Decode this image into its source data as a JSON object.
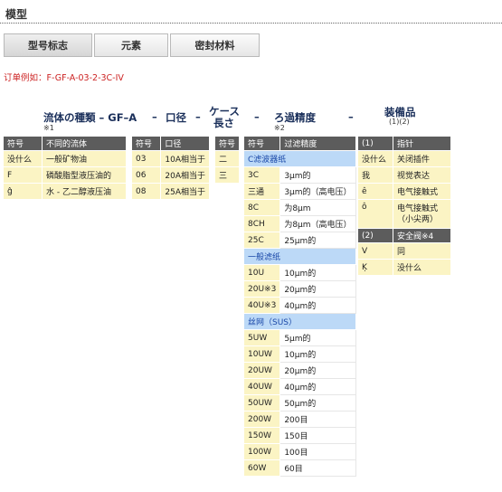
{
  "page": {
    "title": "模型"
  },
  "tabs": [
    {
      "label": "型号标志"
    },
    {
      "label": "元素"
    },
    {
      "label": "密封材料"
    }
  ],
  "example_text": "订单例如：F-GF-A-03-2-3C-IV",
  "headings": {
    "fluid_type": "流体の種類 – GF–A",
    "dash1": "–",
    "port_size": "口径",
    "dash2": "–",
    "case_len_line1": "ケース",
    "case_len_line2": "長さ",
    "dash3": "–",
    "filtration": "ろ過精度",
    "dash4": "–",
    "accessories": "装備品",
    "note1": "※1",
    "note2": "※2",
    "note3": "(1)(2)"
  },
  "fluid_table": {
    "headers": [
      "符号",
      "不同的流体"
    ],
    "rows": [
      [
        "没什么",
        "一般矿物油"
      ],
      [
        "F",
        "磷酸脂型液压油的"
      ],
      [
        "ĝ",
        "水 - 乙二醇液压油"
      ]
    ]
  },
  "port_table": {
    "headers": [
      "符号",
      "口径"
    ],
    "rows": [
      [
        "03",
        "10A相当于"
      ],
      [
        "06",
        "20A相当于"
      ],
      [
        "08",
        "25A相当于"
      ]
    ]
  },
  "case_table": {
    "headers": [
      "符号"
    ],
    "rows": [
      [
        "二"
      ],
      [
        "三"
      ]
    ]
  },
  "filtration_table": {
    "headers": [
      "符号",
      "过滤精度"
    ],
    "sections": [
      {
        "title": "C滤波器纸",
        "rows": [
          [
            "3C",
            "3μm的"
          ],
          [
            "三通",
            "3μm的（高电压）"
          ],
          [
            "8C",
            "为8μm"
          ],
          [
            "8CH",
            "为8μm（高电压）"
          ],
          [
            "25C",
            "25μm的"
          ]
        ]
      },
      {
        "title": "一般滤纸",
        "rows": [
          [
            "10U",
            "10μm的"
          ],
          [
            "20U※3",
            "20μm的"
          ],
          [
            "40U※3",
            "40μm的"
          ]
        ]
      },
      {
        "title": "丝网（SUS）",
        "rows": [
          [
            "5UW",
            "5μm的"
          ],
          [
            "10UW",
            "10μm的"
          ],
          [
            "20UW",
            "20μm的"
          ],
          [
            "40UW",
            "40μm的"
          ],
          [
            "50UW",
            "50μm的"
          ],
          [
            "200W",
            "200目"
          ],
          [
            "150W",
            "150目"
          ],
          [
            "100W",
            "100目"
          ],
          [
            "60W",
            "60目"
          ]
        ]
      }
    ]
  },
  "accessory_table": {
    "groups": [
      {
        "headers": [
          "(1)",
          "指针"
        ],
        "rows": [
          [
            "没什么",
            "关闭插件"
          ],
          [
            "我",
            "视觉表达"
          ],
          [
            "ê",
            "电气接触式"
          ],
          [
            "ô",
            "电气接触式|（小尖两）"
          ]
        ]
      },
      {
        "headers": [
          "(2)",
          "安全阀※4"
        ],
        "rows": [
          [
            "V",
            "同"
          ],
          [
            "Ķ",
            "没什么"
          ]
        ]
      }
    ]
  }
}
